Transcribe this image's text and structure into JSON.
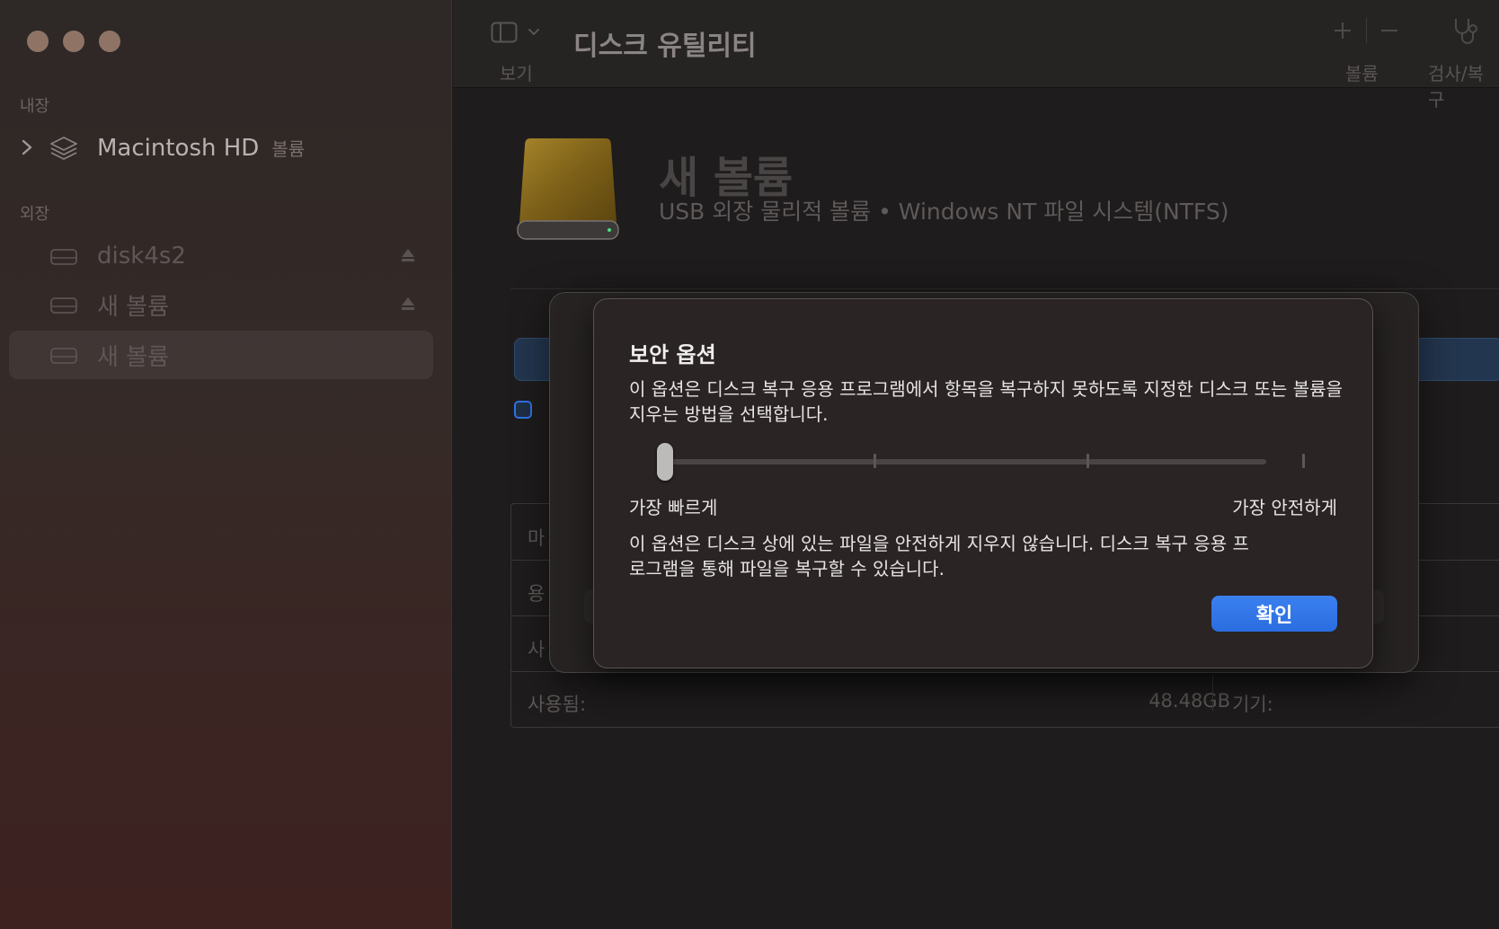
{
  "sidebar": {
    "sections": {
      "internal": "내장",
      "external": "외장"
    },
    "items": [
      {
        "label": "Macintosh HD",
        "sub": "볼륨"
      },
      {
        "label": "disk4s2"
      },
      {
        "label": "새 볼륨"
      },
      {
        "label": "새 볼륨"
      }
    ]
  },
  "toolbar": {
    "title": "디스크 유틸리티",
    "view_label": "보기",
    "volume_label": "볼륨",
    "firstaid_label": "검사/복구"
  },
  "volume": {
    "name": "새 볼륨",
    "description": "USB 외장 물리적 볼륨 • Windows NT 파일 시스템(NTFS)"
  },
  "info": {
    "row1_label": "마",
    "row2_label": "용",
    "row3_label": "사",
    "used_label": "사용됨:",
    "used_value": "48.48GB",
    "device_label": "기기:"
  },
  "dialog": {
    "title": "보안 옵션",
    "description": "이 옵션은 디스크 복구 응용 프로그램에서 항목을 복구하지 못하도록 지정한 디스크 또는 볼륨을 지우는 방법을 선택합니다.",
    "slider_min_label": "가장 빠르게",
    "slider_max_label": "가장 안전하게",
    "slider_position": 0,
    "note": "이 옵션은 디스크 상에 있는 파일을 안전하게 지우지 않습니다. 디스크 복구 응용 프로그램을 통해 파일을 복구할 수 있습니다.",
    "ok_label": "확인"
  },
  "colors": {
    "accent": "#2f73e6",
    "drive_gold": "#8a6a18"
  }
}
